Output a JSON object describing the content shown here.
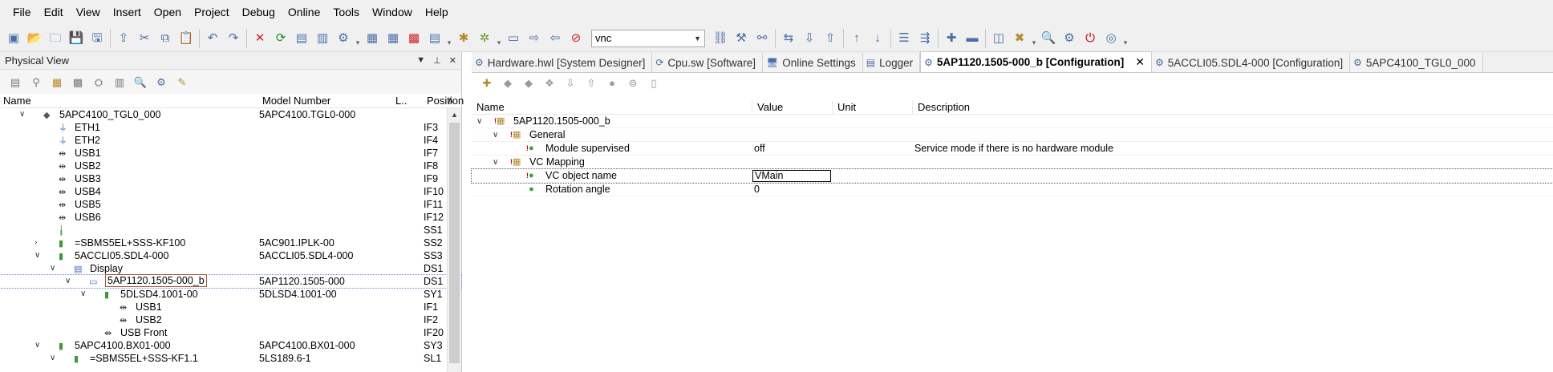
{
  "menu": [
    "File",
    "Edit",
    "View",
    "Insert",
    "Open",
    "Project",
    "Debug",
    "Online",
    "Tools",
    "Window",
    "Help"
  ],
  "toolbar": {
    "search_value": "vnc"
  },
  "left_panel": {
    "title": "Physical View",
    "columns": {
      "name": "Name",
      "model": "Model Number",
      "l": "L..",
      "position": "Position"
    },
    "rows": [
      {
        "name": "5APC4100_TGL0_000",
        "model": "5APC4100.TGL0-000",
        "position": "",
        "depth": 0,
        "expander": "v",
        "icon": "device"
      },
      {
        "name": "ETH1",
        "model": "",
        "position": "IF3",
        "depth": 1,
        "expander": "",
        "icon": "eth"
      },
      {
        "name": "ETH2",
        "model": "",
        "position": "IF4",
        "depth": 1,
        "expander": "",
        "icon": "eth"
      },
      {
        "name": "USB1",
        "model": "",
        "position": "IF7",
        "depth": 1,
        "expander": "",
        "icon": "usb"
      },
      {
        "name": "USB2",
        "model": "",
        "position": "IF8",
        "depth": 1,
        "expander": "",
        "icon": "usb"
      },
      {
        "name": "USB3",
        "model": "",
        "position": "IF9",
        "depth": 1,
        "expander": "",
        "icon": "usb"
      },
      {
        "name": "USB4",
        "model": "",
        "position": "IF10",
        "depth": 1,
        "expander": "",
        "icon": "usb"
      },
      {
        "name": "USB5",
        "model": "",
        "position": "IF11",
        "depth": 1,
        "expander": "",
        "icon": "usb"
      },
      {
        "name": "USB6",
        "model": "",
        "position": "IF12",
        "depth": 1,
        "expander": "",
        "icon": "usb"
      },
      {
        "name": "",
        "model": "",
        "position": "SS1",
        "depth": 1,
        "expander": "",
        "icon": "slot"
      },
      {
        "name": "=SBMS5EL+SSS-KF100",
        "model": "5AC901.IPLK-00",
        "position": "SS2",
        "depth": 1,
        "expander": ">",
        "icon": "module"
      },
      {
        "name": "5ACCLI05.SDL4-000",
        "model": "5ACCLI05.SDL4-000",
        "position": "SS3",
        "depth": 1,
        "expander": "v",
        "icon": "module"
      },
      {
        "name": "Display",
        "model": "",
        "position": "DS1",
        "depth": 2,
        "expander": "v",
        "icon": "display"
      },
      {
        "name": "5AP1120.1505-000_b",
        "model": "5AP1120.1505-000",
        "position": "DS1",
        "depth": 3,
        "expander": "v",
        "icon": "panel",
        "selected": true
      },
      {
        "name": "5DLSD4.1001-00",
        "model": "5DLSD4.1001-00",
        "position": "SY1",
        "depth": 4,
        "expander": "v",
        "icon": "module"
      },
      {
        "name": "USB1",
        "model": "",
        "position": "IF1",
        "depth": 5,
        "expander": "",
        "icon": "usb"
      },
      {
        "name": "USB2",
        "model": "",
        "position": "IF2",
        "depth": 5,
        "expander": "",
        "icon": "usb"
      },
      {
        "name": "USB Front",
        "model": "",
        "position": "IF20",
        "depth": 4,
        "expander": "",
        "icon": "usb"
      },
      {
        "name": "5APC4100.BX01-000",
        "model": "5APC4100.BX01-000",
        "position": "SY3",
        "depth": 1,
        "expander": "v",
        "icon": "module"
      },
      {
        "name": "=SBMS5EL+SSS-KF1.1",
        "model": "5LS189.6-1",
        "position": "SL1",
        "depth": 2,
        "expander": "v",
        "icon": "module"
      }
    ]
  },
  "tabs": [
    {
      "label": "Hardware.hwl [System Designer]",
      "icon": "hardware",
      "active": false
    },
    {
      "label": "Cpu.sw [Software]",
      "icon": "software",
      "active": false
    },
    {
      "label": "Online Settings",
      "icon": "online",
      "active": false
    },
    {
      "label": "Logger",
      "icon": "logger",
      "active": false
    },
    {
      "label": "5AP1120.1505-000_b [Configuration]",
      "icon": "config",
      "active": true
    },
    {
      "label": "5ACCLI05.SDL4-000 [Configuration]",
      "icon": "config",
      "active": false
    },
    {
      "label": "5APC4100_TGL0_000",
      "icon": "config",
      "active": false
    }
  ],
  "config": {
    "columns": {
      "name": "Name",
      "value": "Value",
      "unit": "Unit",
      "description": "Description"
    },
    "rows": [
      {
        "name": "5AP1120.1505-000_b",
        "value": "",
        "description": "",
        "depth": 0,
        "expander": "v",
        "icon": "root"
      },
      {
        "name": "General",
        "value": "",
        "description": "",
        "depth": 1,
        "expander": "v",
        "icon": "folder"
      },
      {
        "name": "Module supervised",
        "value": "off",
        "description": "Service mode if there is no hardware module",
        "depth": 2,
        "expander": "",
        "icon": "param"
      },
      {
        "name": "VC Mapping",
        "value": "",
        "description": "",
        "depth": 1,
        "expander": "v",
        "icon": "folder"
      },
      {
        "name": "VC object name",
        "value": "VMain",
        "description": "",
        "depth": 2,
        "expander": "",
        "icon": "param",
        "selected": true,
        "editing": true
      },
      {
        "name": "Rotation angle",
        "value": "0",
        "description": "",
        "depth": 2,
        "expander": "",
        "icon": "param-ok"
      }
    ]
  }
}
